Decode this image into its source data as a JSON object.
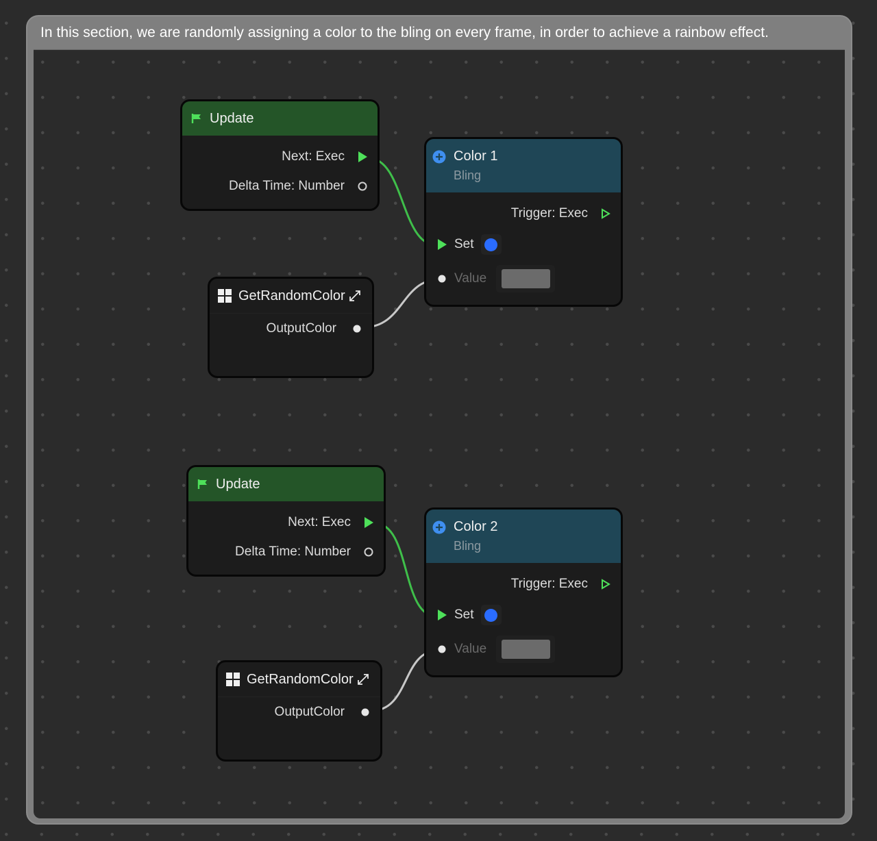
{
  "group": {
    "comment": "In this section, we are randomly assigning a color to the bling on every frame, in order to achieve a rainbow effect."
  },
  "colors": {
    "exec_wire": "#3fbf4a",
    "data_wire": "#c8c8c8",
    "update_header": "#245528",
    "bling_header": "#1f4656",
    "set_dot": "#2a6cff",
    "value_swatch": "#6b6b6b"
  },
  "flows": [
    {
      "update": {
        "title": "Update",
        "icon": "flag-icon",
        "outputs": [
          {
            "label": "Next: Exec",
            "type": "exec",
            "connected": true
          },
          {
            "label": "Delta Time: Number",
            "type": "number",
            "connected": false
          }
        ]
      },
      "get_random_color": {
        "title": "GetRandomColor",
        "icon": "grid-icon",
        "action_icon": "expand-icon",
        "outputs": [
          {
            "label": "OutputColor",
            "type": "color",
            "connected": true
          }
        ]
      },
      "bling": {
        "title": "Color 1",
        "subtitle": "Bling",
        "icon": "plus-circle-icon",
        "outputs": [
          {
            "label": "Trigger: Exec",
            "type": "exec",
            "connected": false
          }
        ],
        "inputs": [
          {
            "label": "Set",
            "type": "exec",
            "connected": true
          },
          {
            "label": "Value",
            "type": "color",
            "connected": true
          }
        ]
      }
    },
    {
      "update": {
        "title": "Update",
        "icon": "flag-icon",
        "outputs": [
          {
            "label": "Next: Exec",
            "type": "exec",
            "connected": true
          },
          {
            "label": "Delta Time: Number",
            "type": "number",
            "connected": false
          }
        ]
      },
      "get_random_color": {
        "title": "GetRandomColor",
        "icon": "grid-icon",
        "action_icon": "expand-icon",
        "outputs": [
          {
            "label": "OutputColor",
            "type": "color",
            "connected": true
          }
        ]
      },
      "bling": {
        "title": "Color 2",
        "subtitle": "Bling",
        "icon": "plus-circle-icon",
        "outputs": [
          {
            "label": "Trigger: Exec",
            "type": "exec",
            "connected": false
          }
        ],
        "inputs": [
          {
            "label": "Set",
            "type": "exec",
            "connected": true
          },
          {
            "label": "Value",
            "type": "color",
            "connected": true
          }
        ]
      }
    }
  ]
}
